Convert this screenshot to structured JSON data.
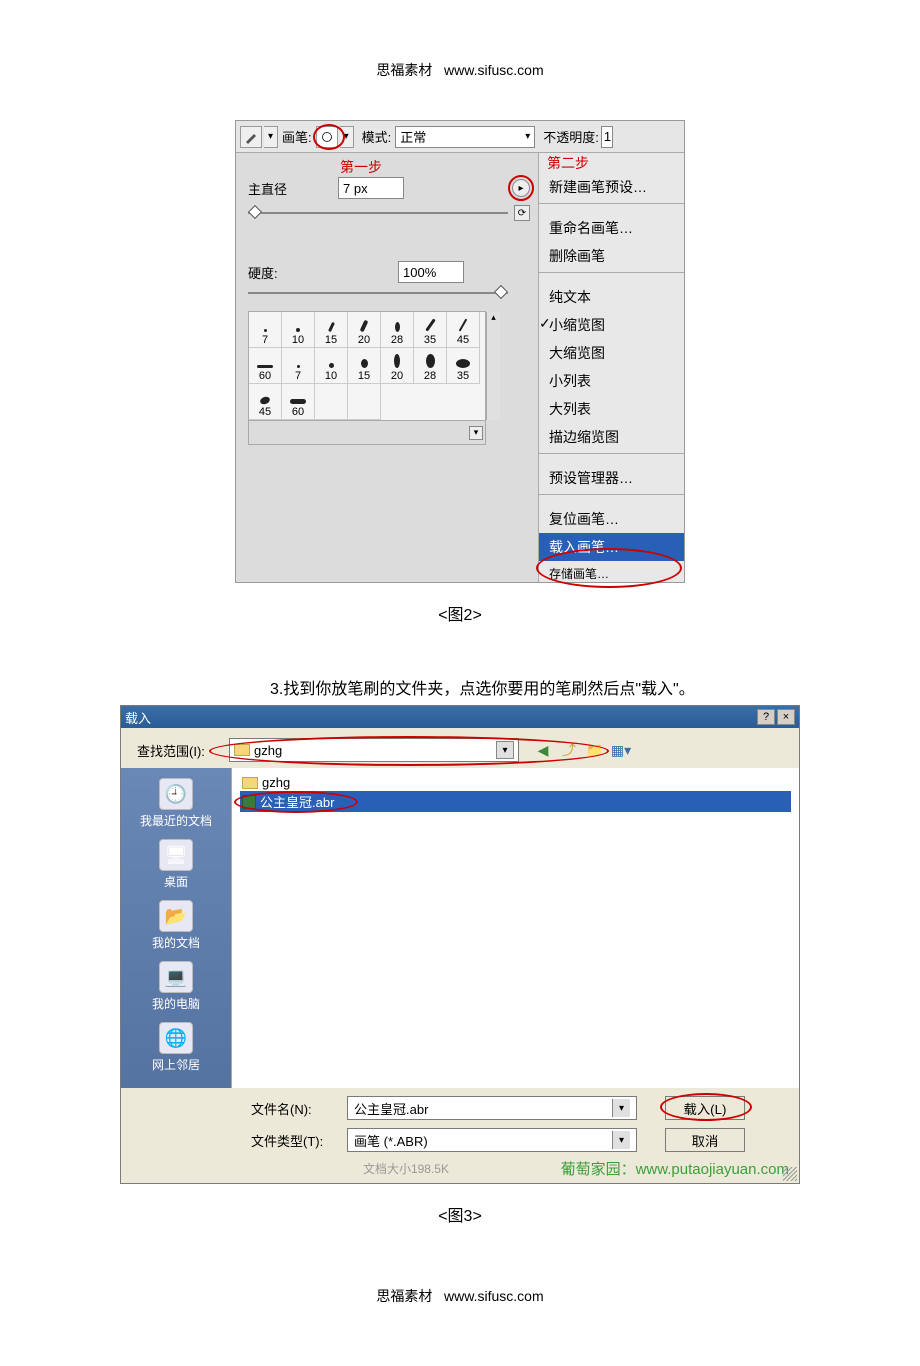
{
  "header": {
    "site_name": "思福素材",
    "site_url": "www.sifusc.com"
  },
  "footer": {
    "site_name": "思福素材",
    "site_url": "www.sifusc.com"
  },
  "fig2": {
    "caption": "<图2>",
    "toolbar": {
      "brush_label": "画笔:",
      "mode_label": "模式:",
      "mode_value": "正常",
      "opacity_label": "不透明度:",
      "opacity_value": "1"
    },
    "steps": {
      "step1": "第一步",
      "step2": "第二步"
    },
    "diameter": {
      "label": "主直径",
      "value": "7 px"
    },
    "hardness": {
      "label": "硬度:",
      "value": "100%"
    },
    "brush_sizes_row1": [
      "7",
      "10",
      "15",
      "20",
      "28",
      "35"
    ],
    "brush_sizes_row2": [
      "45",
      "60",
      "7",
      "10",
      "15",
      "20"
    ],
    "brush_sizes_row3": [
      "28",
      "35",
      "45",
      "60",
      "",
      ""
    ],
    "menu": {
      "new_preset": "新建画笔预设…",
      "rename": "重命名画笔…",
      "delete": "删除画笔",
      "text_only": "纯文本",
      "small_thumb": "小缩览图",
      "large_thumb": "大缩览图",
      "small_list": "小列表",
      "large_list": "大列表",
      "stroke_thumb": "描边缩览图",
      "preset_mgr": "预设管理器…",
      "reset": "复位画笔…",
      "load": "载入画笔…",
      "save": "存储画笔…"
    }
  },
  "instruction3": "3.找到你放笔刷的文件夹，点选你要用的笔刷然后点\"载入\"。",
  "fig3": {
    "caption": "<图3>",
    "title": "载入",
    "help": "?",
    "close": "×",
    "lookin_label": "查找范围(I):",
    "lookin_value": "gzhg",
    "places": {
      "recent": "我最近的文档",
      "desktop": "桌面",
      "mydocs": "我的文档",
      "mycomp": "我的电脑",
      "network": "网上邻居"
    },
    "files": {
      "folder": "gzhg",
      "selected": "公主皇冠.abr"
    },
    "filename_label": "文件名(N):",
    "filename_value": "公主皇冠.abr",
    "filetype_label": "文件类型(T):",
    "filetype_value": "画笔 (*.ABR)",
    "load_btn": "载入(L)",
    "cancel_btn": "取消",
    "watermark_gray": "文档大小198.5K",
    "watermark_green": "葡萄家园：www.putaojiayuan.com"
  }
}
